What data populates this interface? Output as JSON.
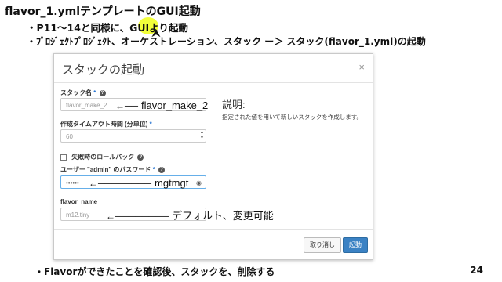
{
  "slide": {
    "title": "flavor_1.ymlテンプレートのGUI起動",
    "bullet1": "・P11～14と同様に、GUIより起動",
    "bullet2": "・ﾌﾟﾛｼﾞｪｸﾄﾌﾟﾛｼﾞｪｸﾄ、オーケストレーション、スタック ー＞ スタック(flavor_1.yml)の起動",
    "bottom_bullet": "・Flavorができたことを確認後、スタックを、削除する",
    "page_number": "24"
  },
  "dialog": {
    "title": "スタックの起動",
    "close": "×",
    "stack_name": {
      "label": "スタック名",
      "required": "*",
      "value": "flavor_make_2"
    },
    "timeout": {
      "label": "作成タイムアウト時間 (分単位)",
      "required": "*",
      "value": "60"
    },
    "rollback": {
      "label": "失敗時のロールバック"
    },
    "password": {
      "label": "ユーザー \"admin\" のパスワード",
      "required": "*",
      "value": "••••••"
    },
    "flavor_name": {
      "label": "flavor_name",
      "value": "m12.tiny"
    },
    "description": {
      "title": "説明:",
      "text": "指定された値を用いて新しいスタックを作成します。"
    },
    "buttons": {
      "cancel": "取り消し",
      "launch": "起動"
    }
  },
  "annotations": {
    "stack_name": "flavor_make_2",
    "password": "mgtmgt",
    "flavor": "デフォルト、変更可能"
  }
}
